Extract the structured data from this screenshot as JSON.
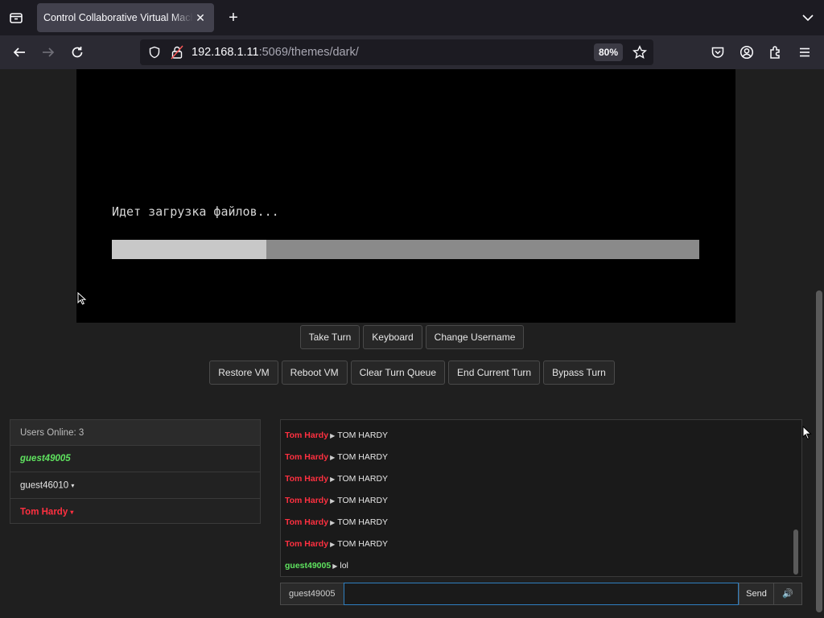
{
  "browser": {
    "tab_title": "Control Collaborative Virtual Machine",
    "tab_close": "✕",
    "new_tab": "+",
    "url_host": "192.168.1.11",
    "url_rest": ":5069/themes/dark/",
    "zoom": "80%"
  },
  "vm": {
    "boot_text": "Идет загрузка файлов...",
    "progress_fraction": 0.263
  },
  "controls": {
    "row1": [
      "Take Turn",
      "Keyboard",
      "Change Username"
    ],
    "row2": [
      "Restore VM",
      "Reboot VM",
      "Clear Turn Queue",
      "End Current Turn",
      "Bypass Turn"
    ]
  },
  "users": {
    "header": "Users Online: 3",
    "list": [
      {
        "name": "guest49005",
        "caret": ""
      },
      {
        "name": "guest46010",
        "caret": "▾"
      },
      {
        "name": "Tom Hardy",
        "caret": "▾"
      }
    ]
  },
  "chat": {
    "arrow": "▶",
    "messages": [
      {
        "user": "Tom Hardy",
        "text": "TOM HARDY"
      },
      {
        "user": "Tom Hardy",
        "text": "TOM HARDY"
      },
      {
        "user": "Tom Hardy",
        "text": "TOM HARDY"
      },
      {
        "user": "Tom Hardy",
        "text": "TOM HARDY"
      },
      {
        "user": "Tom Hardy",
        "text": "TOM HARDY"
      },
      {
        "user": "Tom Hardy",
        "text": "TOM HARDY"
      },
      {
        "user": "guest49005",
        "text": "lol"
      }
    ],
    "username": "guest49005",
    "input_value": "",
    "send_label": "Send",
    "volume_label": "🔊"
  },
  "colors": {
    "own_user": "#5fe35f",
    "other_user_red": "#ff3040",
    "input_focus": "#2f7fc0"
  }
}
